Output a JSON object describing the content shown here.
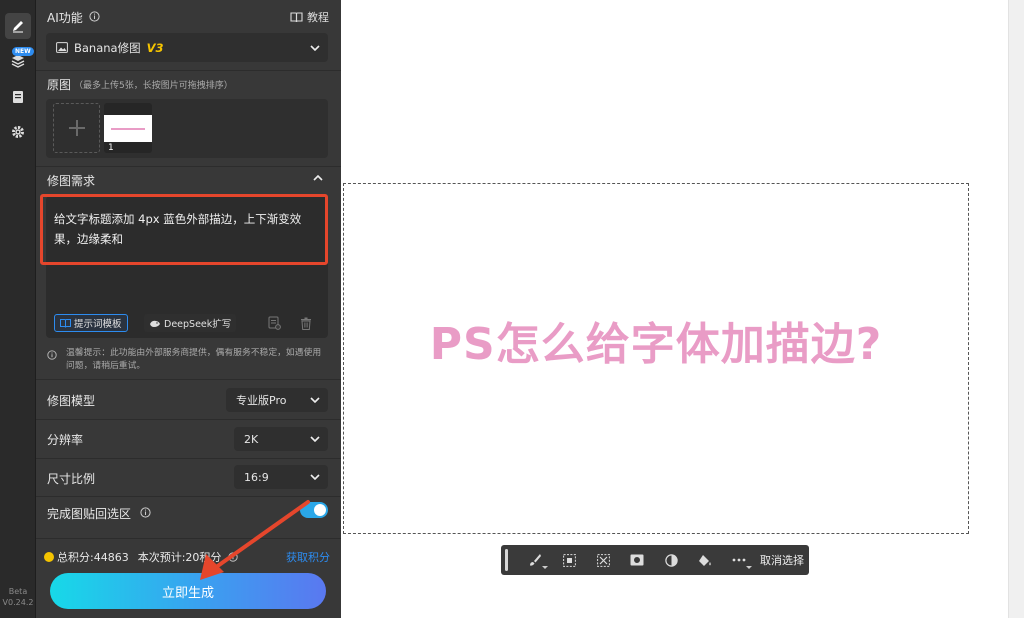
{
  "rail": {
    "new_badge": "NEW",
    "beta_label": "Beta",
    "version": "V0.24.2"
  },
  "header": {
    "title": "AI功能",
    "tutorial_label": "教程"
  },
  "feature_select": {
    "label": "Banana修图",
    "version_tag": "V3"
  },
  "original": {
    "title": "原图",
    "hint": "（最多上传5张，长按图片可拖拽排序）",
    "thumb_index": "1"
  },
  "requirement": {
    "title": "修图需求",
    "text": "给文字标题添加 4px 蓝色外部描边，上下渐变效果，边缘柔和",
    "template_label": "提示词模板",
    "deepseek_label": "DeepSeek扩写"
  },
  "notice": {
    "text": "温馨提示：此功能由外部服务商提供，偶有服务不稳定，如遇使用问题，请稍后重试。"
  },
  "model": {
    "label": "修图模型",
    "value": "专业版Pro"
  },
  "resolution": {
    "label": "分辨率",
    "value": "2K"
  },
  "ratio": {
    "label": "尺寸比例",
    "value": "16:9"
  },
  "paste_back": {
    "label": "完成图贴回选区",
    "enabled": true
  },
  "credits": {
    "total": "总积分:44863",
    "estimate": "本次预计:20积分",
    "get_label": "获取积分"
  },
  "generate": {
    "label": "立即生成"
  },
  "canvas": {
    "title_text": "PS怎么给字体加描边?"
  },
  "float_toolbar": {
    "deselect_label": "取消选择"
  },
  "colors": {
    "accent": "#2d8cf0",
    "danger_box": "#e5462c",
    "title_pink": "#e99cc6",
    "toggle_on": "#2aa7e8"
  }
}
